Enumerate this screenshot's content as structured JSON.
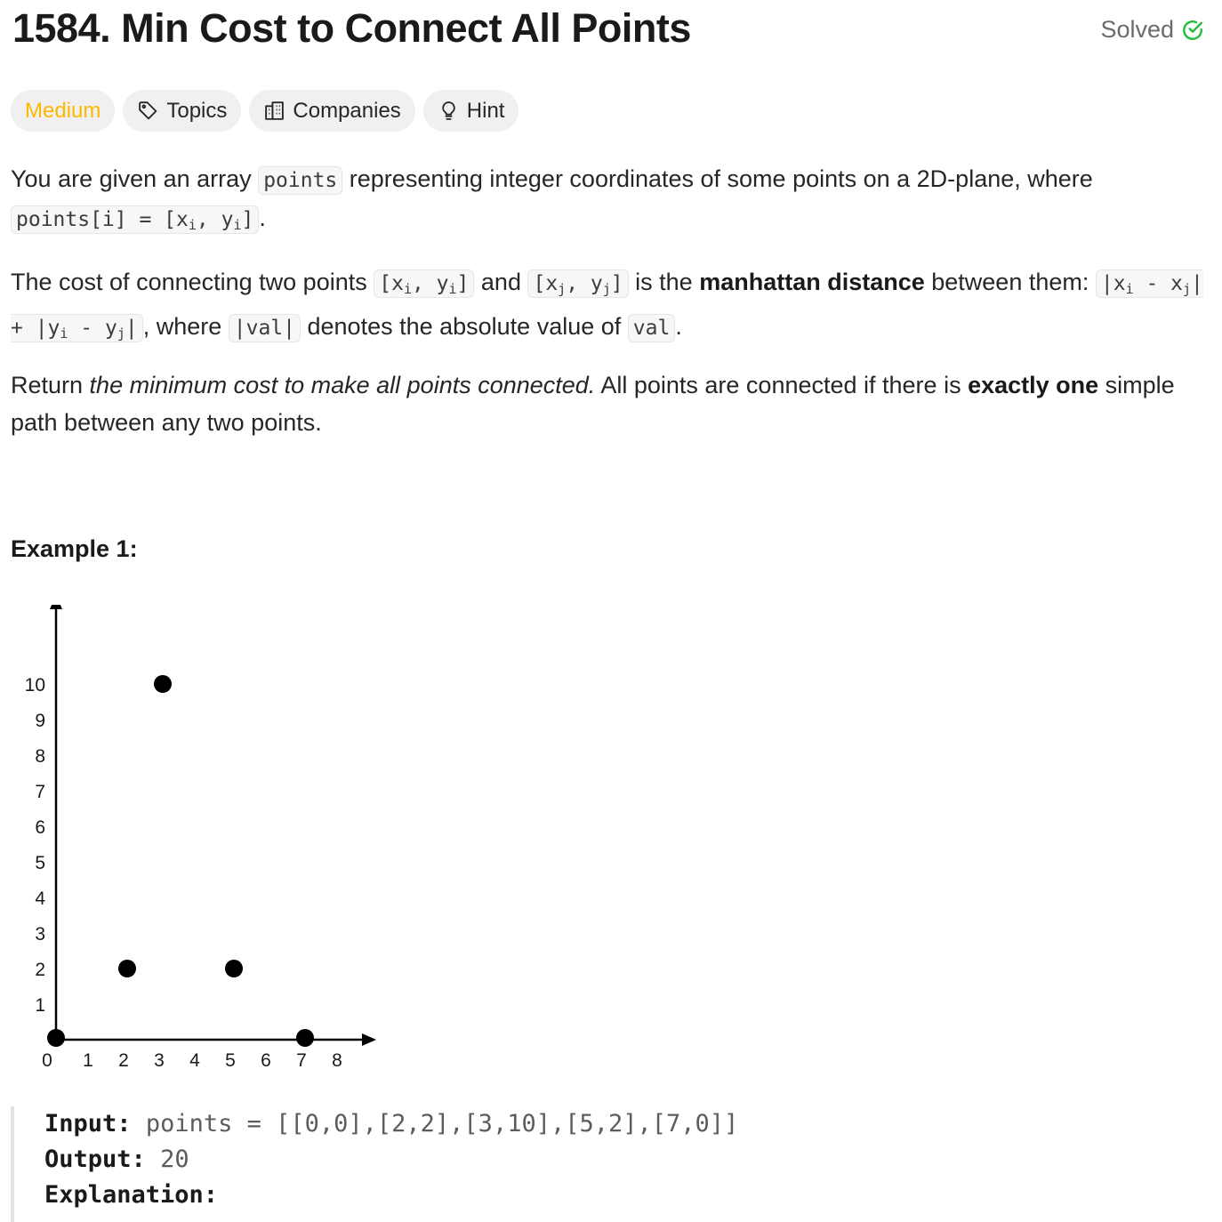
{
  "problem": {
    "title": "1584. Min Cost to Connect All Points",
    "status": "Solved",
    "colors": {
      "solved": "#1fbd3c",
      "medium": "#ffb800"
    }
  },
  "tags": {
    "difficulty": "Medium",
    "topics": "Topics",
    "companies": "Companies",
    "hint": "Hint"
  },
  "description": {
    "p1": {
      "t1": "You are given an array ",
      "c1": "points",
      "t2": " representing integer coordinates of some points on a 2D-plane, where ",
      "c2a": "points[i] = [x",
      "c2s1": "i",
      "c2b": ", y",
      "c2s2": "i",
      "c2c": "]",
      "t3": "."
    },
    "p2": {
      "t1": "The cost of connecting two points ",
      "c1a": "[x",
      "c1s1": "i",
      "c1b": ", y",
      "c1s2": "i",
      "c1c": "]",
      "t2": " and ",
      "c2a": "[x",
      "c2s1": "j",
      "c2b": ", y",
      "c2s2": "j",
      "c2c": "]",
      "t3": " is the ",
      "bold": "manhattan distance",
      "t4": " between them: ",
      "c3a": "|x",
      "c3s1": "i",
      "c3b": " - x",
      "c3s2": "j",
      "c3c": "| + |y",
      "c3s3": "i",
      "c3d": " - y",
      "c3s4": "j",
      "c3e": "|",
      "t5": ", where ",
      "c4": "|val|",
      "t6": " denotes the absolute value of ",
      "c5": "val",
      "t7": "."
    },
    "p3": {
      "t1": "Return ",
      "italic": "the minimum cost to make all points connected.",
      "t2": " All points are connected if there is ",
      "bold": "exactly one",
      "t3": " simple path between any two points."
    }
  },
  "example": {
    "title": "Example 1:",
    "input_label": "Input:",
    "input_value": "points = [[0,0],[2,2],[3,10],[5,2],[7,0]]",
    "output_label": "Output:",
    "output_value": "20",
    "explanation_label": "Explanation:"
  },
  "chart_data": {
    "type": "scatter",
    "x_ticks": [
      "0",
      "1",
      "2",
      "3",
      "4",
      "5",
      "6",
      "7",
      "8"
    ],
    "y_ticks": [
      "1",
      "2",
      "3",
      "4",
      "5",
      "6",
      "7",
      "8",
      "9",
      "10"
    ],
    "xlim": [
      0,
      9
    ],
    "ylim": [
      0,
      12.5
    ],
    "points": [
      {
        "x": 0,
        "y": 0
      },
      {
        "x": 2,
        "y": 2
      },
      {
        "x": 3,
        "y": 10
      },
      {
        "x": 5,
        "y": 2
      },
      {
        "x": 7,
        "y": 0
      }
    ],
    "grid": false
  }
}
